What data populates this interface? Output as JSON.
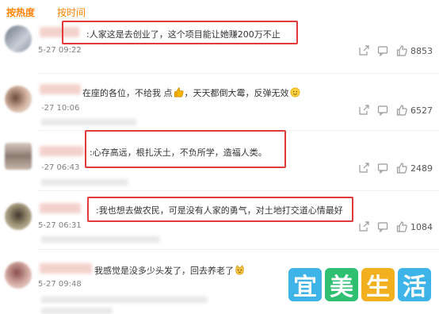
{
  "tabs": {
    "hot": "按热度",
    "time": "按时间"
  },
  "comments": [
    {
      "text": ":人家这是去创业了，这个项目能让她赚200万不止",
      "time": "5-27 09:22",
      "likes": "8853",
      "avatar_color": "#9fa7b6"
    },
    {
      "text": "在座的各位，不给我 点",
      "text_b": "，天天都倒大霉，反弹无效",
      "time": "-27 10:06",
      "likes": "6527",
      "avatar_color": "#c5a496"
    },
    {
      "text": ":心存高远，根扎沃土，不负所学，造福人类。",
      "time": "-27 06:43",
      "likes": "2489",
      "avatar_color": "#b9a9a0"
    },
    {
      "text": ":我也想去做农民，可是没有人家的勇气，对土地打交道心情最好",
      "time": "5-27 06:31",
      "likes": "1084",
      "avatar_color": "#a19a84"
    },
    {
      "text": "我感觉是没多少头发了，回去养老了",
      "time": "5-27 09:48",
      "likes": "",
      "avatar_color": "#caa3a3"
    }
  ],
  "watermark": {
    "chars": [
      "宜",
      "美",
      "生",
      "活"
    ],
    "colors": [
      "#3db3e8",
      "#2fbf71",
      "#f2b01e",
      "#3db3e8"
    ]
  },
  "icons": {
    "share": "share-icon",
    "comment": "comment-icon",
    "like": "thumb-up-icon"
  },
  "accent": "#ff8200",
  "highlight_color": "#e23a3a"
}
